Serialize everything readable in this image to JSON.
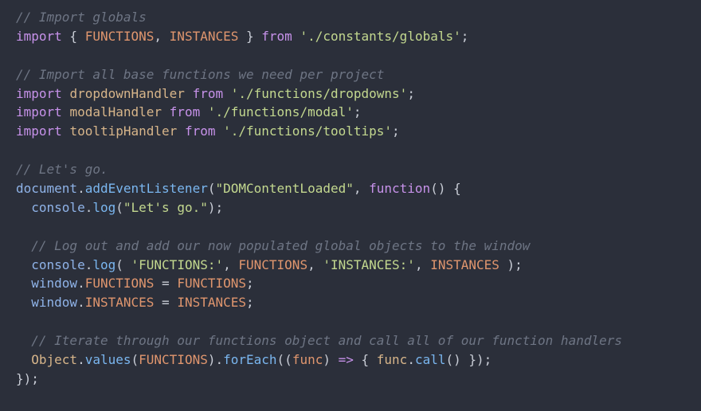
{
  "lines": [
    [
      {
        "t": "// Import globals",
        "c": "comment"
      }
    ],
    [
      {
        "t": "import",
        "c": "keyword"
      },
      {
        "t": " { ",
        "c": "punct"
      },
      {
        "t": "FUNCTIONS",
        "c": "const"
      },
      {
        "t": ", ",
        "c": "punct"
      },
      {
        "t": "INSTANCES",
        "c": "const"
      },
      {
        "t": " } ",
        "c": "punct"
      },
      {
        "t": "from",
        "c": "keyword"
      },
      {
        "t": " ",
        "c": "punct"
      },
      {
        "t": "'./constants/globals'",
        "c": "string"
      },
      {
        "t": ";",
        "c": "punct"
      }
    ],
    [],
    [
      {
        "t": "// Import all base functions we need per project",
        "c": "comment"
      }
    ],
    [
      {
        "t": "import",
        "c": "keyword"
      },
      {
        "t": " ",
        "c": "punct"
      },
      {
        "t": "dropdownHandler",
        "c": "ident"
      },
      {
        "t": " ",
        "c": "punct"
      },
      {
        "t": "from",
        "c": "keyword"
      },
      {
        "t": " ",
        "c": "punct"
      },
      {
        "t": "'./functions/dropdowns'",
        "c": "string"
      },
      {
        "t": ";",
        "c": "punct"
      }
    ],
    [
      {
        "t": "import",
        "c": "keyword"
      },
      {
        "t": " ",
        "c": "punct"
      },
      {
        "t": "modalHandler",
        "c": "ident"
      },
      {
        "t": " ",
        "c": "punct"
      },
      {
        "t": "from",
        "c": "keyword"
      },
      {
        "t": " ",
        "c": "punct"
      },
      {
        "t": "'./functions/modal'",
        "c": "string"
      },
      {
        "t": ";",
        "c": "punct"
      }
    ],
    [
      {
        "t": "import",
        "c": "keyword"
      },
      {
        "t": " ",
        "c": "punct"
      },
      {
        "t": "tooltipHandler",
        "c": "ident"
      },
      {
        "t": " ",
        "c": "punct"
      },
      {
        "t": "from",
        "c": "keyword"
      },
      {
        "t": " ",
        "c": "punct"
      },
      {
        "t": "'./functions/tooltips'",
        "c": "string"
      },
      {
        "t": ";",
        "c": "punct"
      }
    ],
    [],
    [
      {
        "t": "// Let's go.",
        "c": "comment"
      }
    ],
    [
      {
        "t": "document",
        "c": "obj"
      },
      {
        "t": ".",
        "c": "punct"
      },
      {
        "t": "addEventListener",
        "c": "method"
      },
      {
        "t": "(",
        "c": "punct"
      },
      {
        "t": "\"DOMContentLoaded\"",
        "c": "string"
      },
      {
        "t": ", ",
        "c": "punct"
      },
      {
        "t": "function",
        "c": "keyword"
      },
      {
        "t": "() {",
        "c": "punct"
      }
    ],
    [
      {
        "t": "  ",
        "c": "punct"
      },
      {
        "t": "console",
        "c": "obj"
      },
      {
        "t": ".",
        "c": "punct"
      },
      {
        "t": "log",
        "c": "method"
      },
      {
        "t": "(",
        "c": "punct"
      },
      {
        "t": "\"Let's go.\"",
        "c": "string"
      },
      {
        "t": ");",
        "c": "punct"
      }
    ],
    [],
    [
      {
        "t": "  ",
        "c": "punct"
      },
      {
        "t": "// Log out and add our now populated global objects to the window",
        "c": "comment"
      }
    ],
    [
      {
        "t": "  ",
        "c": "punct"
      },
      {
        "t": "console",
        "c": "obj"
      },
      {
        "t": ".",
        "c": "punct"
      },
      {
        "t": "log",
        "c": "method"
      },
      {
        "t": "( ",
        "c": "punct"
      },
      {
        "t": "'FUNCTIONS:'",
        "c": "string"
      },
      {
        "t": ", ",
        "c": "punct"
      },
      {
        "t": "FUNCTIONS",
        "c": "const"
      },
      {
        "t": ", ",
        "c": "punct"
      },
      {
        "t": "'INSTANCES:'",
        "c": "string"
      },
      {
        "t": ", ",
        "c": "punct"
      },
      {
        "t": "INSTANCES",
        "c": "const"
      },
      {
        "t": " );",
        "c": "punct"
      }
    ],
    [
      {
        "t": "  ",
        "c": "punct"
      },
      {
        "t": "window",
        "c": "obj"
      },
      {
        "t": ".",
        "c": "punct"
      },
      {
        "t": "FUNCTIONS",
        "c": "const"
      },
      {
        "t": " = ",
        "c": "punct"
      },
      {
        "t": "FUNCTIONS",
        "c": "const"
      },
      {
        "t": ";",
        "c": "punct"
      }
    ],
    [
      {
        "t": "  ",
        "c": "punct"
      },
      {
        "t": "window",
        "c": "obj"
      },
      {
        "t": ".",
        "c": "punct"
      },
      {
        "t": "INSTANCES",
        "c": "const"
      },
      {
        "t": " = ",
        "c": "punct"
      },
      {
        "t": "INSTANCES",
        "c": "const"
      },
      {
        "t": ";",
        "c": "punct"
      }
    ],
    [],
    [
      {
        "t": "  ",
        "c": "punct"
      },
      {
        "t": "// Iterate through our functions object and call all of our function handlers",
        "c": "comment"
      }
    ],
    [
      {
        "t": "  ",
        "c": "punct"
      },
      {
        "t": "Object",
        "c": "ident"
      },
      {
        "t": ".",
        "c": "punct"
      },
      {
        "t": "values",
        "c": "method"
      },
      {
        "t": "(",
        "c": "punct"
      },
      {
        "t": "FUNCTIONS",
        "c": "const"
      },
      {
        "t": ").",
        "c": "punct"
      },
      {
        "t": "forEach",
        "c": "method"
      },
      {
        "t": "((",
        "c": "punct"
      },
      {
        "t": "func",
        "c": "param"
      },
      {
        "t": ") ",
        "c": "punct"
      },
      {
        "t": "=>",
        "c": "op"
      },
      {
        "t": " { ",
        "c": "punct"
      },
      {
        "t": "func",
        "c": "ident"
      },
      {
        "t": ".",
        "c": "punct"
      },
      {
        "t": "call",
        "c": "method"
      },
      {
        "t": "() });",
        "c": "punct"
      }
    ],
    [
      {
        "t": "});",
        "c": "punct"
      }
    ]
  ],
  "colors": {
    "background": "#2b2f3a",
    "comment": "#6e7584",
    "keyword": "#c792ea",
    "const": "#e0966e",
    "string": "#c3d88f",
    "ident": "#d7b58a",
    "obj": "#8fb3e8",
    "method": "#7ab6ef",
    "punct": "#c9cdd6"
  }
}
